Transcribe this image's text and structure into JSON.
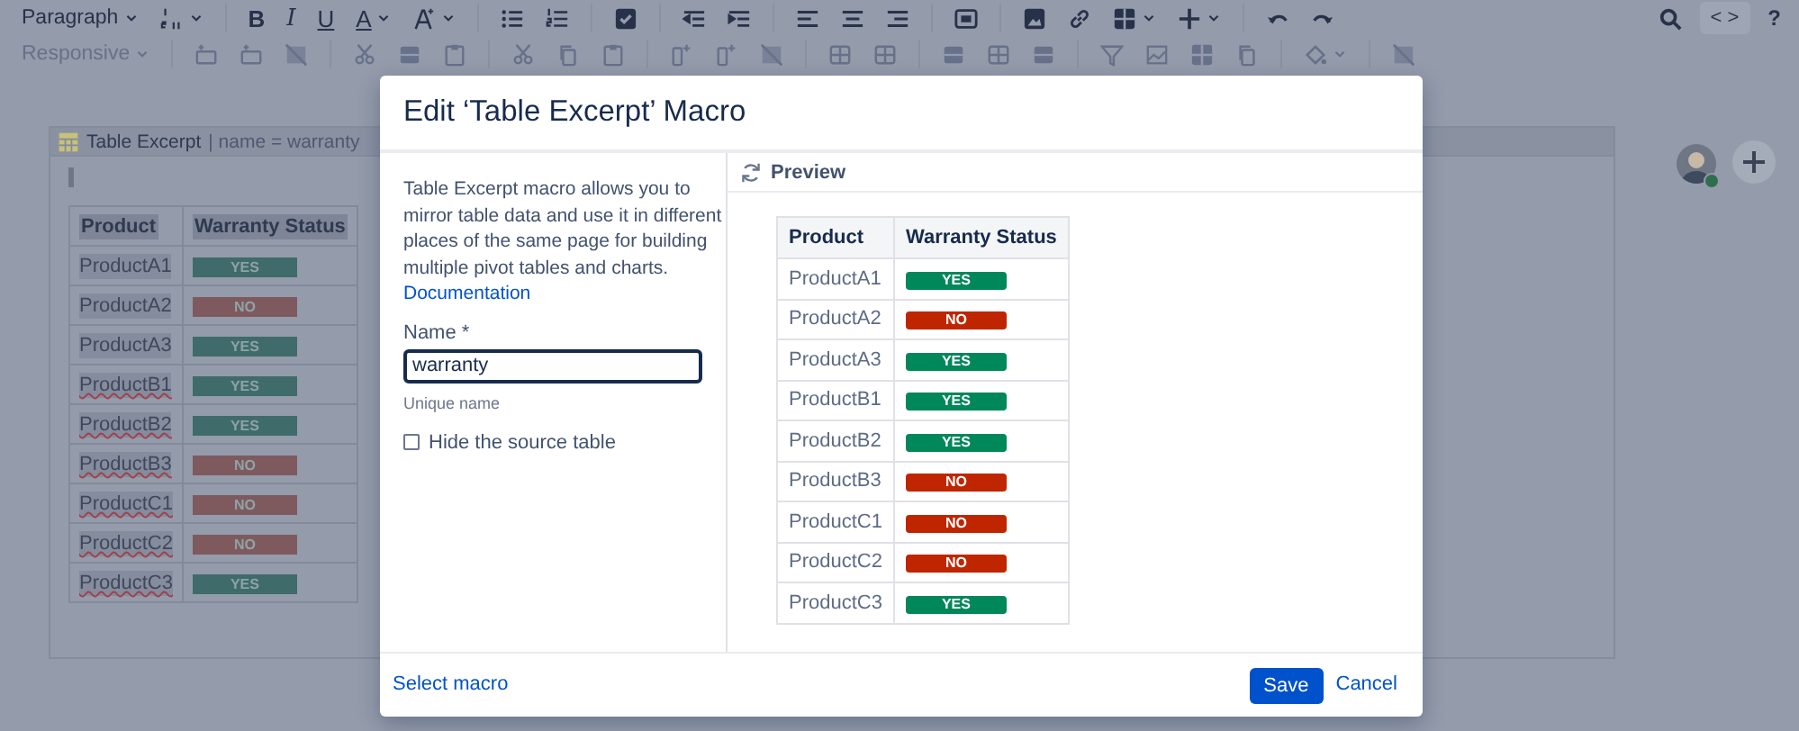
{
  "toolbar": {
    "style_dropdown": "Paragraph",
    "bold": "B",
    "italic": "I",
    "underline": "U",
    "text_color": "A",
    "source_button": "< >",
    "help_button": "?",
    "width_dropdown": "Responsive"
  },
  "macro_block": {
    "title": "Table Excerpt",
    "params": "| name = warranty",
    "columns": [
      "Product",
      "Warranty Status"
    ],
    "rows": [
      {
        "product": "ProductA1",
        "status": "YES",
        "color": "#3f6b6b",
        "misspelled": false
      },
      {
        "product": "ProductA2",
        "status": "NO",
        "color": "#7e5a5e",
        "misspelled": false
      },
      {
        "product": "ProductA3",
        "status": "YES",
        "color": "#3f6b6b",
        "misspelled": false
      },
      {
        "product": "ProductB1",
        "status": "YES",
        "color": "#3f6b6b",
        "misspelled": true
      },
      {
        "product": "ProductB2",
        "status": "YES",
        "color": "#3f6b6b",
        "misspelled": true
      },
      {
        "product": "ProductB3",
        "status": "NO",
        "color": "#7e5a5e",
        "misspelled": true
      },
      {
        "product": "ProductC1",
        "status": "NO",
        "color": "#7e5a5e",
        "misspelled": true
      },
      {
        "product": "ProductC2",
        "status": "NO",
        "color": "#7e5a5e",
        "misspelled": true
      },
      {
        "product": "ProductC3",
        "status": "YES",
        "color": "#3f6b6b",
        "misspelled": true
      }
    ]
  },
  "dialog": {
    "title": "Edit ‘Table Excerpt’ Macro",
    "description": "Table Excerpt macro allows you to mirror table data and use it in different places of the same page for building multiple pivot tables and charts.",
    "doc_link": "Documentation",
    "name_field": {
      "label": "Name *",
      "value": "warranty",
      "hint": "Unique name"
    },
    "hide_source": {
      "label": "Hide the source table",
      "checked": false
    },
    "preview": {
      "title": "Preview",
      "columns": [
        "Product",
        "Warranty Status"
      ],
      "rows": [
        {
          "product": "ProductA1",
          "status": "YES",
          "color": "#00875a"
        },
        {
          "product": "ProductA2",
          "status": "NO",
          "color": "#bf2600"
        },
        {
          "product": "ProductA3",
          "status": "YES",
          "color": "#00875a"
        },
        {
          "product": "ProductB1",
          "status": "YES",
          "color": "#00875a"
        },
        {
          "product": "ProductB2",
          "status": "YES",
          "color": "#00875a"
        },
        {
          "product": "ProductB3",
          "status": "NO",
          "color": "#bf2600"
        },
        {
          "product": "ProductC1",
          "status": "NO",
          "color": "#bf2600"
        },
        {
          "product": "ProductC2",
          "status": "NO",
          "color": "#bf2600"
        },
        {
          "product": "ProductC3",
          "status": "YES",
          "color": "#00875a"
        }
      ]
    },
    "footer": {
      "select_macro": "Select macro",
      "save": "Save",
      "cancel": "Cancel"
    }
  }
}
